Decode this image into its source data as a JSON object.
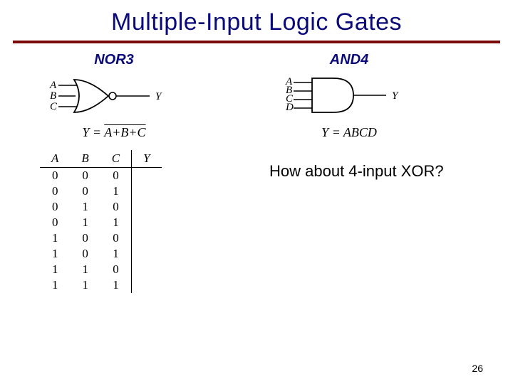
{
  "title": "Multiple-Input Logic Gates",
  "nor3": {
    "label": "NOR3",
    "inputs": [
      "A",
      "B",
      "C"
    ],
    "output": "Y",
    "equation_lhs": "Y = ",
    "equation_rhs": "A+B+C"
  },
  "and4": {
    "label": "AND4",
    "inputs": [
      "A",
      "B",
      "C",
      "D"
    ],
    "output": "Y",
    "equation": "Y = ABCD"
  },
  "truth": {
    "headers": [
      "A",
      "B",
      "C",
      "Y"
    ],
    "rows": [
      [
        "0",
        "0",
        "0",
        ""
      ],
      [
        "0",
        "0",
        "1",
        ""
      ],
      [
        "0",
        "1",
        "0",
        ""
      ],
      [
        "0",
        "1",
        "1",
        ""
      ],
      [
        "1",
        "0",
        "0",
        ""
      ],
      [
        "1",
        "0",
        "1",
        ""
      ],
      [
        "1",
        "1",
        "0",
        ""
      ],
      [
        "1",
        "1",
        "1",
        ""
      ]
    ]
  },
  "question": "How about 4-input XOR?",
  "page": "26"
}
